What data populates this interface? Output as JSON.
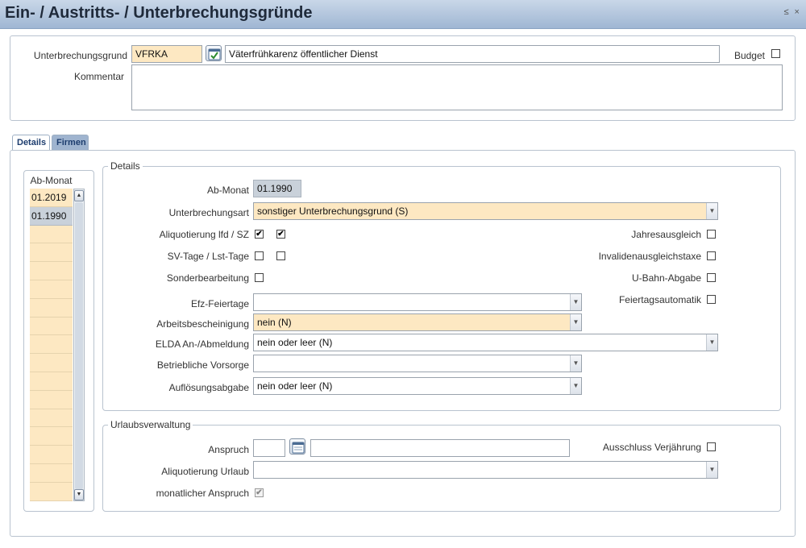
{
  "window": {
    "title": "Ein- / Austritts- / Unterbrechungsgründe",
    "controls": "≤ ×"
  },
  "header": {
    "grund_label": "Unterbrechungsgrund",
    "grund_code": "VFRKA",
    "grund_text": "Väterfrühkarenz öffentlicher Dienst",
    "budget_label": "Budget",
    "budget_checked": false,
    "kommentar_label": "Kommentar",
    "kommentar_value": ""
  },
  "tabs": [
    {
      "label": "Details",
      "active": true
    },
    {
      "label": "Firmen",
      "active": false
    }
  ],
  "ab_monat_list": {
    "header": "Ab-Monat",
    "items": [
      "01.2019",
      "01.1990",
      "",
      "",
      "",
      "",
      "",
      "",
      "",
      "",
      "",
      "",
      "",
      "",
      "",
      "",
      ""
    ],
    "selected_index": 1
  },
  "details": {
    "legend": "Details",
    "ab_monat_label": "Ab-Monat",
    "ab_monat_value": "01.1990",
    "unterbrechungsart_label": "Unterbrechungsart",
    "unterbrechungsart_value": "sonstiger Unterbrechungsgrund (S)",
    "aliquotierung_label": "Aliquotierung lfd / SZ",
    "aliquotierung_lfd": true,
    "aliquotierung_sz": true,
    "svtage_label": "SV-Tage / Lst-Tage",
    "svtage": false,
    "lsttage": false,
    "sonderbearbeitung_label": "Sonderbearbeitung",
    "sonderbearbeitung": false,
    "efz_label": "Efz-Feiertage",
    "efz_value": "",
    "arbeitsbescheinigung_label": "Arbeitsbescheinigung",
    "arbeitsbescheinigung_value": "nein (N)",
    "elda_label": "ELDA An-/Abmeldung",
    "elda_value": "nein oder leer (N)",
    "vorsorge_label": "Betriebliche Vorsorge",
    "vorsorge_value": "",
    "aufloesung_label": "Auflösungsabgabe",
    "aufloesung_value": "nein oder leer (N)",
    "jahresausgleich_label": "Jahresausgleich",
    "jahresausgleich": false,
    "invaliden_label": "Invalidenausgleichstaxe",
    "invaliden": false,
    "ubahn_label": "U-Bahn-Abgabe",
    "ubahn": false,
    "feiertag_label": "Feiertagsautomatik",
    "feiertag": false
  },
  "urlaub": {
    "legend": "Urlaubsverwaltung",
    "anspruch_label": "Anspruch",
    "anspruch_value": "",
    "anspruch_text": "",
    "ausschluss_label": "Ausschluss Verjährung",
    "ausschluss": false,
    "aliquotierung_label": "Aliquotierung Urlaub",
    "aliquotierung_value": "",
    "monatlich_label": "monatlicher Anspruch",
    "monatlich": true
  },
  "colors": {
    "required_field": "#fde8c2",
    "readonly_field": "#c9d1da",
    "title_bar": "#b4c6de"
  }
}
